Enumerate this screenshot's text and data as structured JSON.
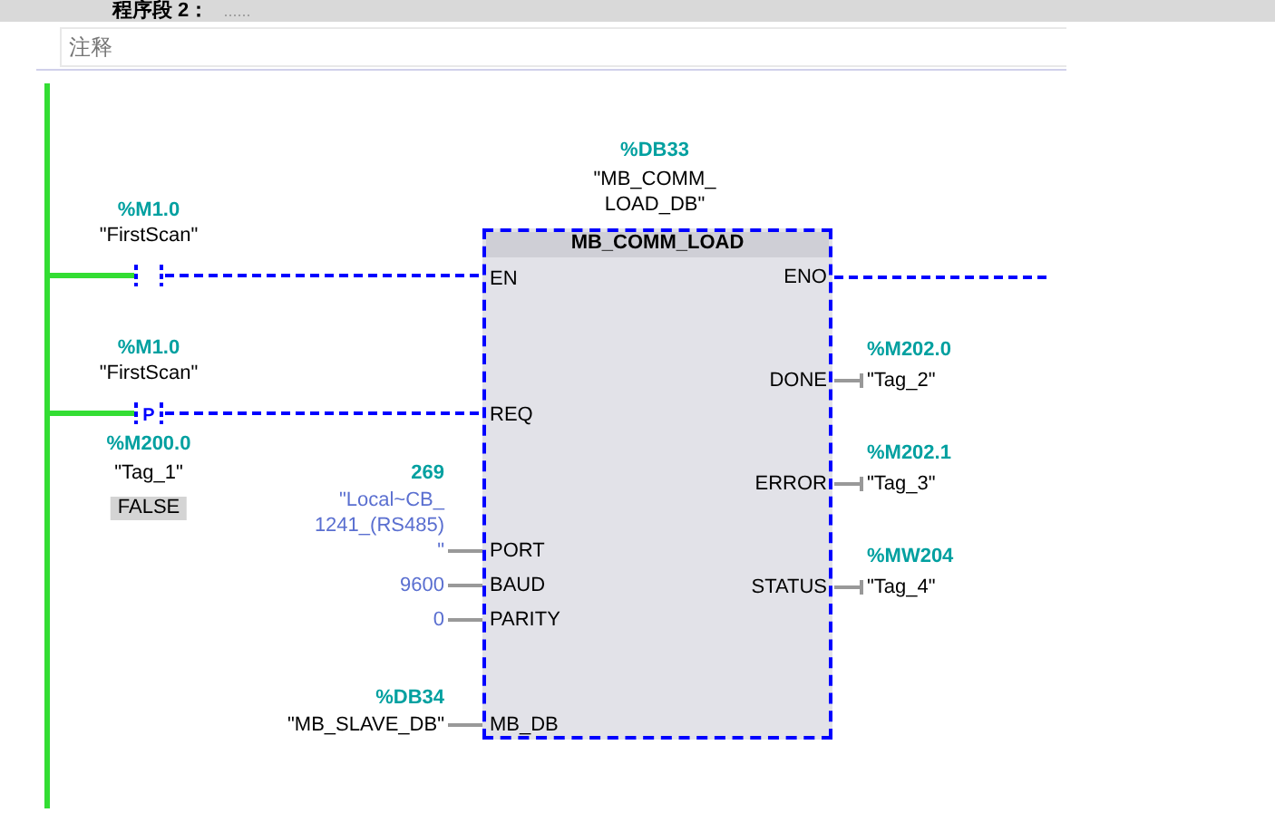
{
  "network": {
    "title": "程序段 2：",
    "title_comment": "......",
    "comment": {
      "placeholder": "注释"
    }
  },
  "rungs": [
    {
      "kind": "contact",
      "address": "%M1.0",
      "tag": "\"FirstScan\""
    },
    {
      "kind": "p_contact",
      "address": "%M1.0",
      "tag": "\"FirstScan\"",
      "edge_label": "P",
      "edge_address": "%M200.0",
      "edge_tag": "\"Tag_1\"",
      "edge_value": "FALSE"
    }
  ],
  "block": {
    "instance_address": "%DB33",
    "instance_name_lines": [
      "\"MB_COMM_",
      "LOAD_DB\""
    ],
    "type": "MB_COMM_LOAD",
    "inputs": [
      {
        "pin": "EN",
        "kind": "power"
      },
      {
        "pin": "REQ",
        "kind": "power"
      },
      {
        "pin": "PORT",
        "kind": "constant",
        "address": "269",
        "value_lines": [
          "\"Local~CB_",
          "1241_(RS485)",
          "\""
        ]
      },
      {
        "pin": "BAUD",
        "kind": "constant",
        "value_lines": [
          "9600"
        ]
      },
      {
        "pin": "PARITY",
        "kind": "constant",
        "value_lines": [
          "0"
        ]
      },
      {
        "pin": "MB_DB",
        "kind": "tag",
        "address": "%DB34",
        "value_lines": [
          "\"MB_SLAVE_DB\""
        ]
      }
    ],
    "outputs": [
      {
        "pin": "ENO",
        "kind": "power"
      },
      {
        "pin": "DONE",
        "kind": "tag",
        "address": "%M202.0",
        "tag": "\"Tag_2\""
      },
      {
        "pin": "ERROR",
        "kind": "tag",
        "address": "%M202.1",
        "tag": "\"Tag_3\""
      },
      {
        "pin": "STATUS",
        "kind": "tag",
        "address": "%MW204",
        "tag": "\"Tag_4\""
      }
    ]
  }
}
